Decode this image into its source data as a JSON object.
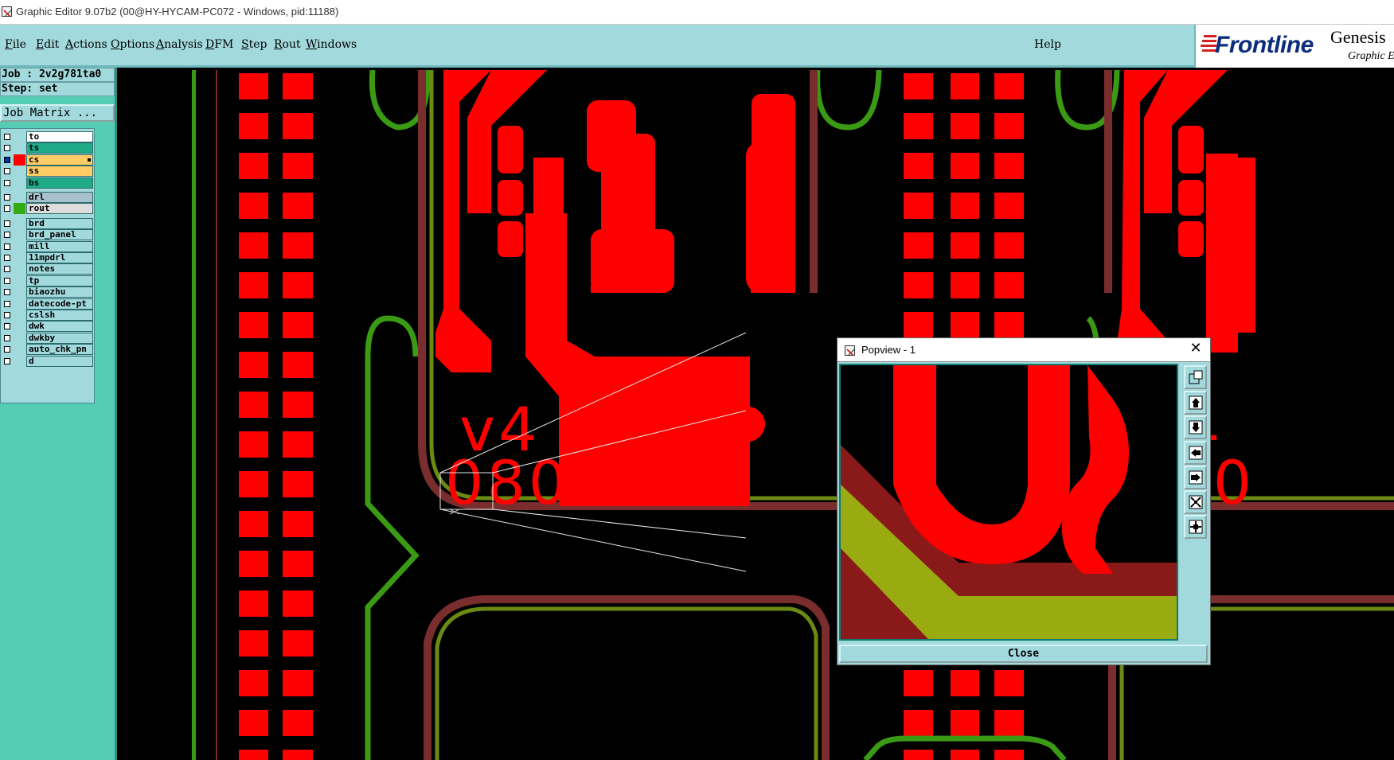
{
  "window": {
    "title": "Graphic Editor 9.07b2 (00@HY-HYCAM-PC072 - Windows, pid:11188)"
  },
  "menubar": {
    "items": [
      {
        "label": "File"
      },
      {
        "label": "Edit"
      },
      {
        "label": "Actions"
      },
      {
        "label": "Options"
      },
      {
        "label": "Analysis"
      },
      {
        "label": "DFM"
      },
      {
        "label": "Step"
      },
      {
        "label": "Rout"
      },
      {
        "label": "Windows"
      }
    ],
    "help": "Help"
  },
  "logo": {
    "brand": "Frontline",
    "product": "Genesis",
    "subtitle": "Graphic E"
  },
  "sidebar": {
    "job": "Job : 2v2g781ta0",
    "step": "Step: set",
    "job_matrix_button": "Job Matrix ...",
    "layers": [
      {
        "name": "to",
        "checked": false,
        "swatch": "",
        "bg": "#ffffff"
      },
      {
        "name": "ts",
        "checked": false,
        "swatch": "",
        "bg": "#1faa88"
      },
      {
        "name": "cs",
        "checked": true,
        "swatch": "#ff0000",
        "bg": "#ffcc66",
        "marked": true
      },
      {
        "name": "ss",
        "checked": false,
        "swatch": "",
        "bg": "#ffcc66"
      },
      {
        "name": "bs",
        "checked": false,
        "swatch": "",
        "bg": "#1faa88"
      },
      {
        "name": "drl",
        "checked": false,
        "swatch": "",
        "bg": "#a8c0cc",
        "gap": true
      },
      {
        "name": "rout",
        "checked": false,
        "swatch": "#33aa11",
        "bg": "#dddddd"
      },
      {
        "name": "brd",
        "checked": false,
        "swatch": "",
        "bg": "#a2d9dd",
        "gap": true
      },
      {
        "name": "brd_panel",
        "checked": false,
        "swatch": "",
        "bg": "#a2d9dd"
      },
      {
        "name": "mill",
        "checked": false,
        "swatch": "",
        "bg": "#a2d9dd"
      },
      {
        "name": "11mpdrl",
        "checked": false,
        "swatch": "",
        "bg": "#a2d9dd"
      },
      {
        "name": "notes",
        "checked": false,
        "swatch": "",
        "bg": "#a2d9dd"
      },
      {
        "name": "tp",
        "checked": false,
        "swatch": "",
        "bg": "#a2d9dd"
      },
      {
        "name": "biaozhu",
        "checked": false,
        "swatch": "",
        "bg": "#a2d9dd"
      },
      {
        "name": "datecode-pt",
        "checked": false,
        "swatch": "",
        "bg": "#a2d9dd"
      },
      {
        "name": "cslsh",
        "checked": false,
        "swatch": "",
        "bg": "#a2d9dd"
      },
      {
        "name": "dwk",
        "checked": false,
        "swatch": "",
        "bg": "#a2d9dd"
      },
      {
        "name": "dwkby",
        "checked": false,
        "swatch": "",
        "bg": "#a2d9dd"
      },
      {
        "name": "auto_chk_pn",
        "checked": false,
        "swatch": "",
        "bg": "#a2d9dd"
      },
      {
        "name": "d",
        "checked": false,
        "swatch": "",
        "bg": "#a2d9dd"
      }
    ]
  },
  "canvas": {
    "marking_1": "v4",
    "marking_2": "080",
    "colors": {
      "copper": "#ff0000",
      "rout": "#3a9a14",
      "board": "#000000"
    }
  },
  "popview": {
    "title": "Popview - 1",
    "close_button": "Close",
    "toolbar": [
      "zoom-window-icon",
      "pan-up-icon",
      "pan-down-icon",
      "pan-left-icon",
      "pan-right-icon",
      "zoom-fit-icon",
      "zoom-home-icon"
    ]
  }
}
